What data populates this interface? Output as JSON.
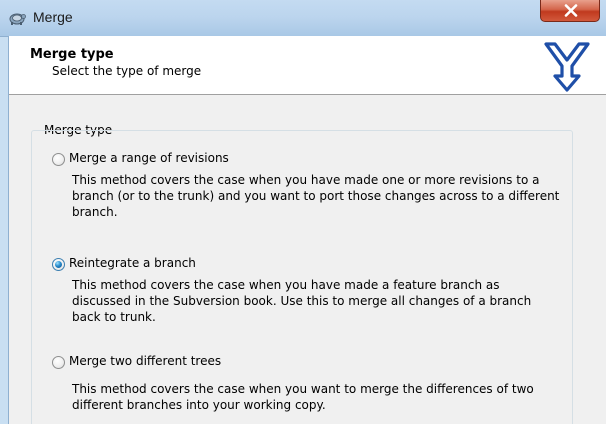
{
  "window": {
    "title": "Merge",
    "background_text": "",
    "close_icon": "close-icon"
  },
  "header": {
    "title": "Merge type",
    "subtitle": "Select the type of merge",
    "logo_icon": "merge-arrow-logo-icon"
  },
  "group": {
    "legend": "Merge type",
    "options": [
      {
        "label": "Merge a range of revisions",
        "description": "This method covers the case when you have made one or more revisions to a branch (or to the trunk) and you want to port those changes across to a different branch.",
        "checked": false
      },
      {
        "label": "Reintegrate a branch",
        "description": "This method covers the case when you have made a feature branch as discussed in the Subversion book. Use this to merge all changes of a branch back to trunk.",
        "checked": true
      },
      {
        "label": "Merge two different trees",
        "description": "This method covers the case when you want to merge the differences of two different branches into your working copy.",
        "checked": false
      }
    ]
  },
  "colors": {
    "logo_blue": "#1f4fa8",
    "close_red": "#c0391e",
    "radio_selected": "#2b8ccc"
  }
}
